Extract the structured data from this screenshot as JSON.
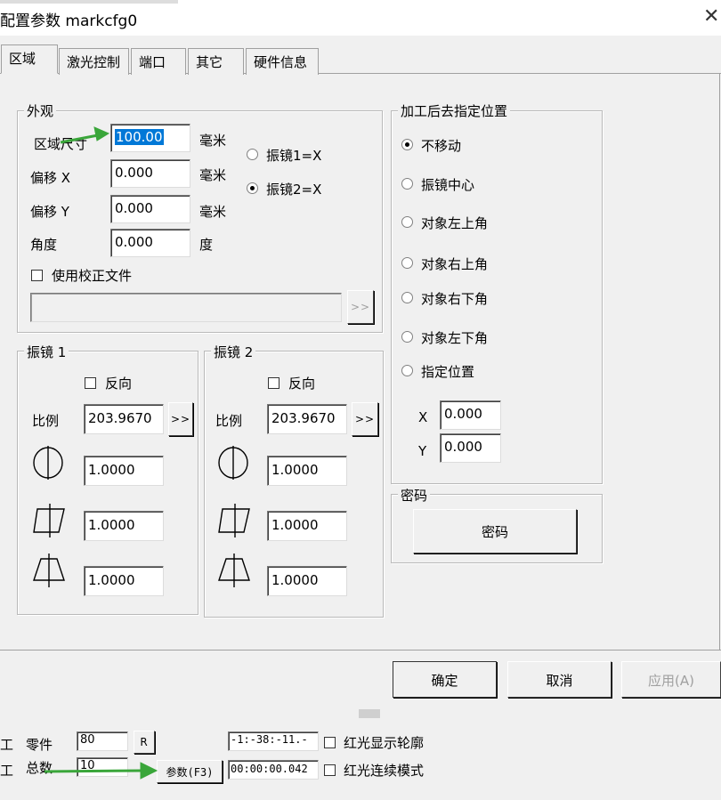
{
  "window": {
    "title": "配置参数 markcfg0",
    "close": "✕"
  },
  "tabs": [
    {
      "label": "区域",
      "active": true
    },
    {
      "label": "激光控制"
    },
    {
      "label": "端口"
    },
    {
      "label": "其它"
    },
    {
      "label": "硬件信息"
    }
  ],
  "appearance": {
    "group_label": "外观",
    "area_size_label": "区域尺寸",
    "area_size_value": "100.00",
    "offset_x_label": "偏移 X",
    "offset_x_value": "0.000",
    "offset_y_label": "偏移 Y",
    "offset_y_value": "0.000",
    "angle_label": "角度",
    "angle_value": "0.000",
    "unit_mm": "毫米",
    "unit_deg": "度",
    "galvo1_x_label": "振镜1=X",
    "galvo2_x_label": "振镜2=X",
    "galvo_selected": 2,
    "use_correction_label": "使用校正文件",
    "correction_path": "",
    "browse_label": ">>"
  },
  "galvo1": {
    "group_label": "振镜 1",
    "reverse_label": "反向",
    "scale_label": "比例",
    "scale_value": "203.9670",
    "scale_btn": ">>",
    "v1": "1.0000",
    "v2": "1.0000",
    "v3": "1.0000"
  },
  "galvo2": {
    "group_label": "振镜 2",
    "reverse_label": "反向",
    "scale_label": "比例",
    "scale_value": "203.9670",
    "scale_btn": ">>",
    "v1": "1.0000",
    "v2": "1.0000",
    "v3": "1.0000"
  },
  "after_process": {
    "group_label": "加工后去指定位置",
    "options": [
      "不移动",
      "振镜中心",
      "对象左上角",
      "对象右上角",
      "对象右下角",
      "对象左下角",
      "指定位置"
    ],
    "selected_index": 0,
    "x_label": "X",
    "x_value": "0.000",
    "y_label": "Y",
    "y_value": "0.000"
  },
  "password": {
    "group_label": "密码",
    "button_label": "密码"
  },
  "footer": {
    "ok": "确定",
    "cancel": "取消",
    "apply": "应用(A)"
  },
  "background_app": {
    "left_char1": "工",
    "left_char2": "工",
    "part_label": "零件",
    "part_value": "80",
    "r_button": "R",
    "total_label": "总数",
    "total_value": "10",
    "params_button": "参数(F3)",
    "coords_text": "-1:-38:-11.-",
    "time_text": "00:00:00.042",
    "red_outline_label": "红光显示轮廓",
    "red_continuous_label": "红光连续模式"
  },
  "colors": {
    "accent": "#0078d7",
    "arrow": "#3aa63a"
  }
}
